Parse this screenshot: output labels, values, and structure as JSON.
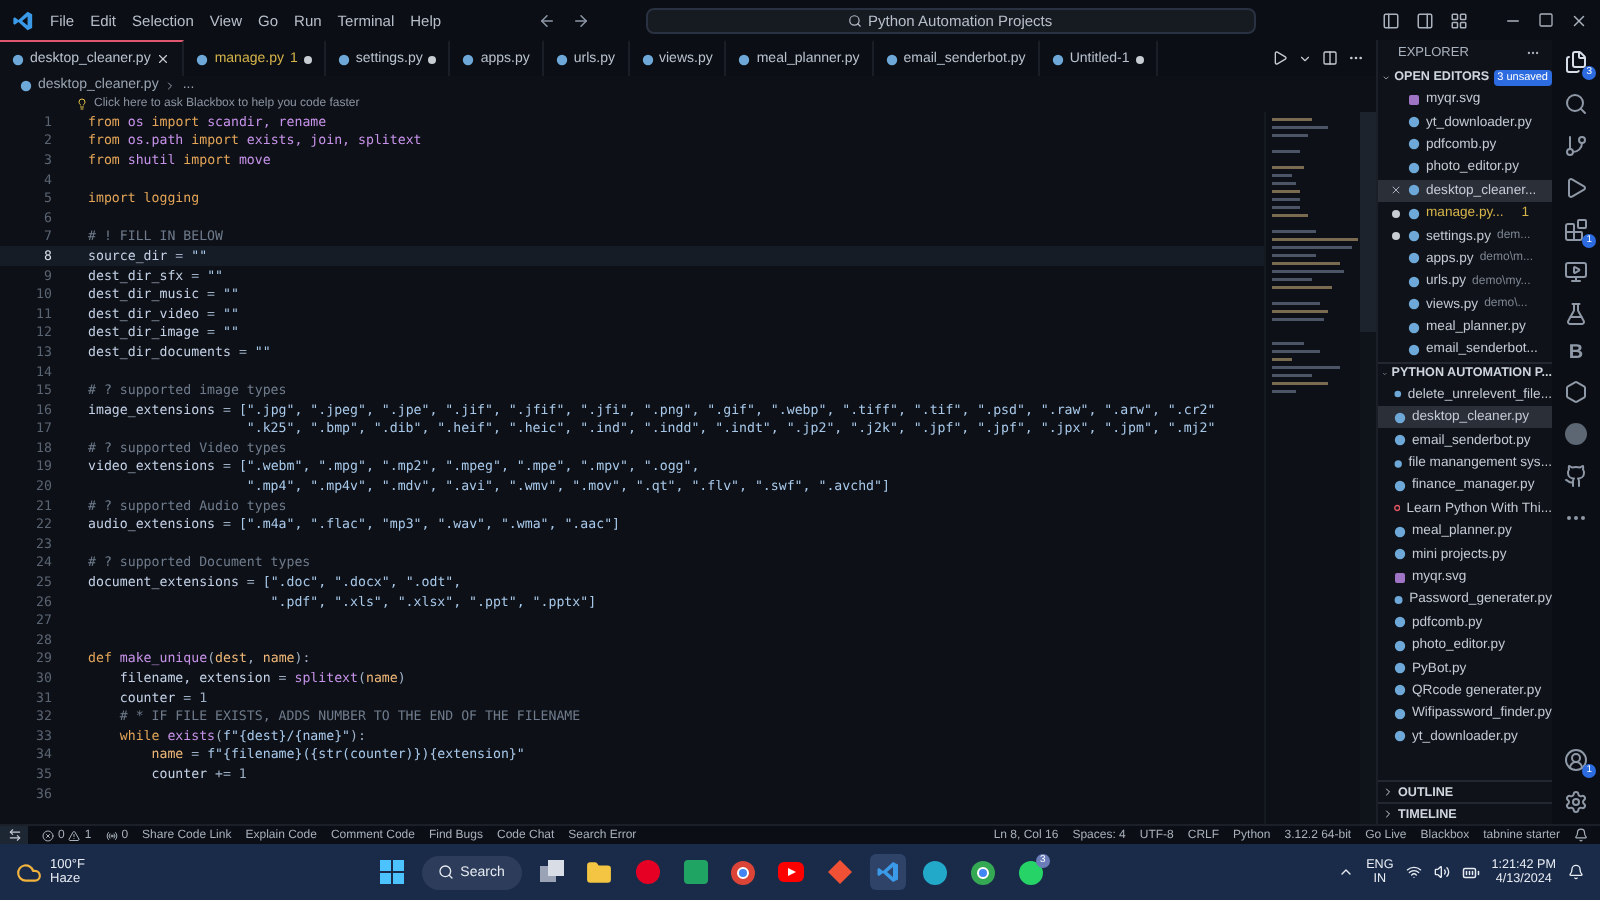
{
  "menu": [
    "File",
    "Edit",
    "Selection",
    "View",
    "Go",
    "Run",
    "Terminal",
    "Help"
  ],
  "command_center": {
    "text": "Python Automation Projects"
  },
  "tabs": [
    {
      "label": "desktop_cleaner.py",
      "selected": true,
      "modified": false,
      "warning": false
    },
    {
      "label": "manage.py",
      "badge": "1",
      "selected": false,
      "modified": true,
      "warning": true
    },
    {
      "label": "settings.py",
      "selected": false,
      "modified": true,
      "warning": false
    },
    {
      "label": "apps.py",
      "selected": false,
      "modified": false,
      "warning": false
    },
    {
      "label": "urls.py",
      "selected": false,
      "modified": false,
      "warning": false
    },
    {
      "label": "views.py",
      "selected": false,
      "modified": false,
      "warning": false
    },
    {
      "label": "meal_planner.py",
      "selected": false,
      "modified": false,
      "warning": false
    },
    {
      "label": "email_senderbot.py",
      "selected": false,
      "modified": false,
      "warning": false
    },
    {
      "label": "Untitled-1",
      "selected": false,
      "modified": true,
      "warning": false
    }
  ],
  "breadcrumb": [
    "desktop_cleaner.py",
    "..."
  ],
  "codelens": "Click here to ask Blackbox to help you code faster",
  "lines": [
    {
      "n": "1",
      "current": false,
      "tokens": [
        {
          "t": "from",
          "kind": "keyword"
        },
        {
          "t": " os ",
          "kind": "name"
        },
        {
          "t": "import",
          "kind": "keyword"
        },
        {
          "t": " scandir, rename",
          "kind": "name"
        }
      ]
    },
    {
      "n": "2",
      "current": false,
      "tokens": [
        {
          "t": "from",
          "kind": "keyword"
        },
        {
          "t": " os.path ",
          "kind": "name"
        },
        {
          "t": "import",
          "kind": "keyword"
        },
        {
          "t": " exists, join, splitext",
          "kind": "name"
        }
      ]
    },
    {
      "n": "3",
      "current": false,
      "tokens": [
        {
          "t": "from",
          "kind": "keyword"
        },
        {
          "t": " shutil ",
          "kind": "name"
        },
        {
          "t": "import",
          "kind": "keyword"
        },
        {
          "t": " move",
          "kind": "name"
        }
      ]
    },
    {
      "n": "4",
      "current": false
    },
    {
      "n": "5",
      "current": false,
      "tokens": [
        {
          "t": "import logging",
          "kind": "keyword"
        }
      ]
    },
    {
      "n": "6",
      "current": false
    },
    {
      "n": "7",
      "current": false,
      "tokens": [
        {
          "t": "# ! FILL IN BELOW",
          "kind": "comment"
        }
      ]
    },
    {
      "n": "8",
      "current": true,
      "tokens": [
        {
          "t": "source_dir",
          "kind": "variable"
        },
        {
          "t": " = ",
          "kind": "operator"
        },
        {
          "t": "\"\"",
          "kind": "string"
        }
      ]
    },
    {
      "n": "9",
      "current": false,
      "tokens": [
        {
          "t": "dest_dir_sfx",
          "kind": "variable"
        },
        {
          "t": " = ",
          "kind": "operator"
        },
        {
          "t": "\"\"",
          "kind": "string"
        }
      ]
    },
    {
      "n": "10",
      "current": false,
      "tokens": [
        {
          "t": "dest_dir_music",
          "kind": "variable"
        },
        {
          "t": " = ",
          "kind": "operator"
        },
        {
          "t": "\"\"",
          "kind": "string"
        }
      ]
    },
    {
      "n": "11",
      "current": false,
      "tokens": [
        {
          "t": "dest_dir_video",
          "kind": "variable"
        },
        {
          "t": " = ",
          "kind": "operator"
        },
        {
          "t": "\"\"",
          "kind": "string"
        }
      ]
    },
    {
      "n": "12",
      "current": false,
      "tokens": [
        {
          "t": "dest_dir_image",
          "kind": "variable"
        },
        {
          "t": " = ",
          "kind": "operator"
        },
        {
          "t": "\"\"",
          "kind": "string"
        }
      ]
    },
    {
      "n": "13",
      "current": false,
      "tokens": [
        {
          "t": "dest_dir_documents",
          "kind": "variable"
        },
        {
          "t": " = ",
          "kind": "operator"
        },
        {
          "t": "\"\"",
          "kind": "string"
        }
      ]
    },
    {
      "n": "14",
      "current": false
    },
    {
      "n": "15",
      "current": false,
      "tokens": [
        {
          "t": "# ? supported image types",
          "kind": "comment"
        }
      ]
    },
    {
      "n": "16",
      "current": false,
      "tokens": [
        {
          "t": "image_extensions",
          "kind": "variable"
        },
        {
          "t": " = ",
          "kind": "operator"
        },
        {
          "t": "[\".jpg\", \".jpeg\", \".jpe\", \".jif\", \".jfif\", \".jfi\", \".png\", \".gif\", \".webp\", \".tiff\", \".tif\", \".psd\", \".raw\", \".arw\", \".cr2\"",
          "kind": "string"
        }
      ]
    },
    {
      "n": "17",
      "current": false,
      "tokens": [
        {
          "t": "                    \".k25\", \".bmp\", \".dib\", \".heif\", \".heic\", \".ind\", \".indd\", \".indt\", \".jp2\", \".j2k\", \".jpf\", \".jpf\", \".jpx\", \".jpm\", \".mj2\"",
          "kind": "string"
        }
      ]
    },
    {
      "n": "18",
      "current": false,
      "tokens": [
        {
          "t": "# ? supported Video types",
          "kind": "comment"
        }
      ]
    },
    {
      "n": "19",
      "current": false,
      "tokens": [
        {
          "t": "video_extensions",
          "kind": "variable"
        },
        {
          "t": " = ",
          "kind": "operator"
        },
        {
          "t": "[\".webm\", \".mpg\", \".mp2\", \".mpeg\", \".mpe\", \".mpv\", \".ogg\",",
          "kind": "string"
        }
      ]
    },
    {
      "n": "20",
      "current": false,
      "tokens": [
        {
          "t": "                    \".mp4\", \".mp4v\", \".mdv\", \".avi\", \".wmv\", \".mov\", \".qt\", \".flv\", \".swf\", \".avchd\"]",
          "kind": "string"
        }
      ]
    },
    {
      "n": "21",
      "current": false,
      "tokens": [
        {
          "t": "# ? supported Audio types",
          "kind": "comment"
        }
      ]
    },
    {
      "n": "22",
      "current": false,
      "tokens": [
        {
          "t": "audio_extensions",
          "kind": "variable"
        },
        {
          "t": " = ",
          "kind": "operator"
        },
        {
          "t": "[\".m4a\", \".flac\", \"mp3\", \".wav\", \".wma\", \".aac\"]",
          "kind": "string"
        }
      ]
    },
    {
      "n": "23",
      "current": false
    },
    {
      "n": "24",
      "current": false,
      "tokens": [
        {
          "t": "# ? supported Document types",
          "kind": "comment"
        }
      ]
    },
    {
      "n": "25",
      "current": false,
      "tokens": [
        {
          "t": "document_extensions",
          "kind": "variable"
        },
        {
          "t": " = ",
          "kind": "operator"
        },
        {
          "t": "[\".doc\", \".docx\", \".odt\",",
          "kind": "string"
        }
      ]
    },
    {
      "n": "26",
      "current": false,
      "tokens": [
        {
          "t": "                       \".pdf\", \".xls\", \".xlsx\", \".ppt\", \".pptx\"]",
          "kind": "string"
        }
      ]
    },
    {
      "n": "27",
      "current": false
    },
    {
      "n": "28",
      "current": false
    },
    {
      "n": "29",
      "current": false,
      "tokens": [
        {
          "t": "def",
          "kind": "keyword"
        },
        {
          "t": " make_unique",
          "kind": "name"
        },
        {
          "t": "(",
          "kind": "operator"
        },
        {
          "t": "dest",
          "kind": "parameter"
        },
        {
          "t": ", ",
          "kind": "operator"
        },
        {
          "t": "name",
          "kind": "parameter"
        },
        {
          "t": "):",
          "kind": "operator"
        }
      ]
    },
    {
      "n": "30",
      "current": false,
      "tokens": [
        {
          "t": "    filename, extension",
          "kind": "variable"
        },
        {
          "t": " = ",
          "kind": "operator"
        },
        {
          "t": "splitext",
          "kind": "name"
        },
        {
          "t": "(",
          "kind": "operator"
        },
        {
          "t": "name",
          "kind": "parameter"
        },
        {
          "t": ")",
          "kind": "operator"
        }
      ]
    },
    {
      "n": "31",
      "current": false,
      "tokens": [
        {
          "t": "    counter",
          "kind": "variable"
        },
        {
          "t": " = 1",
          "kind": "operator"
        }
      ]
    },
    {
      "n": "32",
      "current": false,
      "tokens": [
        {
          "t": "    # * IF FILE EXISTS, ADDS NUMBER TO THE END OF THE FILENAME",
          "kind": "comment"
        }
      ]
    },
    {
      "n": "33",
      "current": false,
      "tokens": [
        {
          "t": "    while",
          "kind": "keyword"
        },
        {
          "t": " exists",
          "kind": "name"
        },
        {
          "t": "(",
          "kind": "operator"
        },
        {
          "t": "f\"{dest}/{name}\"",
          "kind": "string"
        },
        {
          "t": "):",
          "kind": "operator"
        }
      ]
    },
    {
      "n": "34",
      "current": false,
      "tokens": [
        {
          "t": "        name",
          "kind": "parameter"
        },
        {
          "t": " = ",
          "kind": "operator"
        },
        {
          "t": "f\"{filename}({str(counter)}){extension}\"",
          "kind": "string"
        }
      ]
    },
    {
      "n": "35",
      "current": false,
      "tokens": [
        {
          "t": "        counter",
          "kind": "variable"
        },
        {
          "t": " += 1",
          "kind": "operator"
        }
      ]
    },
    {
      "n": "36",
      "current": false
    }
  ],
  "explorer": {
    "title": "EXPLORER",
    "open_editors": {
      "title": "OPEN EDITORS",
      "badge": "3 unsaved",
      "items": [
        {
          "name": "myqr.svg",
          "kind": "svg",
          "selected": false,
          "modified": false
        },
        {
          "name": "yt_downloader.py",
          "kind": "py",
          "selected": false,
          "modified": false
        },
        {
          "name": "pdfcomb.py",
          "kind": "py",
          "selected": false,
          "modified": false
        },
        {
          "name": "photo_editor.py",
          "kind": "py",
          "selected": false,
          "modified": false
        },
        {
          "name": "desktop_cleaner...",
          "kind": "py",
          "selected": true,
          "modified": false
        },
        {
          "name": "manage.py...",
          "kind": "py",
          "selected": false,
          "modified": true,
          "badge": "1"
        },
        {
          "name": "settings.py",
          "description": "dem...",
          "kind": "py",
          "selected": false,
          "modified": true
        },
        {
          "name": "apps.py",
          "description": "demo\\m...",
          "kind": "py",
          "selected": false,
          "modified": false
        },
        {
          "name": "urls.py",
          "description": "demo\\my...",
          "kind": "py",
          "selected": false,
          "modified": false
        },
        {
          "name": "views.py",
          "description": "demo\\...",
          "kind": "py",
          "selected": false,
          "modified": false
        },
        {
          "name": "meal_planner.py",
          "kind": "py",
          "selected": false,
          "modified": false
        },
        {
          "name": "email_senderbot...",
          "kind": "py",
          "selected": false,
          "modified": false
        }
      ]
    },
    "folder": {
      "title": "PYTHON AUTOMATION P...",
      "items": [
        {
          "name": "delete_unrelevent_file...",
          "kind": "py",
          "selected": false
        },
        {
          "name": "desktop_cleaner.py",
          "kind": "py",
          "selected": true
        },
        {
          "name": "email_senderbot.py",
          "kind": "py",
          "selected": false
        },
        {
          "name": "file manangement sys...",
          "kind": "py",
          "selected": false
        },
        {
          "name": "finance_manager.py",
          "kind": "py",
          "selected": false
        },
        {
          "name": "Learn Python With Thi...",
          "kind": "pdf",
          "selected": false
        },
        {
          "name": "meal_planner.py",
          "kind": "py",
          "selected": false
        },
        {
          "name": "mini projects.py",
          "kind": "py",
          "selected": false
        },
        {
          "name": "myqr.svg",
          "kind": "svg",
          "selected": false
        },
        {
          "name": "Password_generater.py",
          "kind": "py",
          "selected": false
        },
        {
          "name": "pdfcomb.py",
          "kind": "py",
          "selected": false
        },
        {
          "name": "photo_editor.py",
          "kind": "py",
          "selected": false
        },
        {
          "name": "PyBot.py",
          "kind": "py",
          "selected": false
        },
        {
          "name": "QRcode generater.py",
          "kind": "py",
          "selected": false
        },
        {
          "name": "Wifipassword_finder.py",
          "kind": "py",
          "selected": false
        },
        {
          "name": "yt_downloader.py",
          "kind": "py",
          "selected": false
        }
      ]
    },
    "outline": "OUTLINE",
    "timeline": "TIMELINE"
  },
  "activity_bar": {
    "explorer_badge": "3",
    "extensions_badge": "1",
    "b_label": "B",
    "account_badge": "1"
  },
  "status_bar": {
    "errors": "0",
    "warnings": "1",
    "ports": "0",
    "left": [
      "Share Code Link",
      "Explain Code",
      "Comment Code",
      "Find Bugs",
      "Code Chat",
      "Search Error"
    ],
    "right": [
      "Ln 8, Col 16",
      "Spaces: 4",
      "UTF-8",
      "CRLF",
      "Python",
      "3.12.2 64-bit",
      "Go Live",
      "Blackbox",
      "tabnine starter"
    ]
  },
  "taskbar": {
    "temperature": "100°F",
    "condition": "Haze",
    "search": "Search",
    "whatsapp_badge": "3",
    "language": "ENG",
    "region": "IN",
    "time": "1:21:42 PM",
    "date": "4/13/2024"
  }
}
